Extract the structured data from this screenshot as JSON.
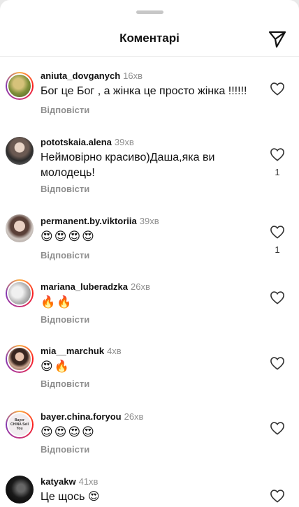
{
  "header": {
    "title": "Коментарі",
    "share_icon": "paper-plane-icon"
  },
  "comments": [
    {
      "username": "aniuta_dovganych",
      "time": "16хв",
      "text": "Бог це Бог , а жінка це просто жінка !!!!!!",
      "reply": "Відповісти",
      "likes": "",
      "story_ring": true
    },
    {
      "username": "pototskaia.alena",
      "time": "39хв",
      "text": "Неймовірно красиво)Даша,яка ви молодець!",
      "reply": "Відповісти",
      "likes": "1",
      "story_ring": false
    },
    {
      "username": "permanent.by.viktoriia",
      "time": "39хв",
      "text": "😍😍😍😍",
      "reply": "Відповісти",
      "likes": "1",
      "story_ring": false
    },
    {
      "username": "mariana_luberadzka",
      "time": "26хв",
      "text": "🔥🔥",
      "reply": "Відповісти",
      "likes": "",
      "story_ring": true
    },
    {
      "username": "mia__marchuk",
      "time": "4хв",
      "text": "😍🔥",
      "reply": "Відповісти",
      "likes": "",
      "story_ring": true
    },
    {
      "username": "bayer.china.foryou",
      "time": "26хв",
      "text": "😍😍😍😍",
      "reply": "Відповісти",
      "likes": "",
      "story_ring": true,
      "avatar_text": "Bayer CHINA Sell You"
    },
    {
      "username": "katyakw",
      "time": "41хв",
      "text": "Це щось 😍",
      "reply": "",
      "likes": "",
      "story_ring": false
    }
  ],
  "colors": {
    "accent_ring_start": "#fcb045",
    "accent_ring_end": "#833ab4",
    "muted": "#8e8e8e"
  }
}
